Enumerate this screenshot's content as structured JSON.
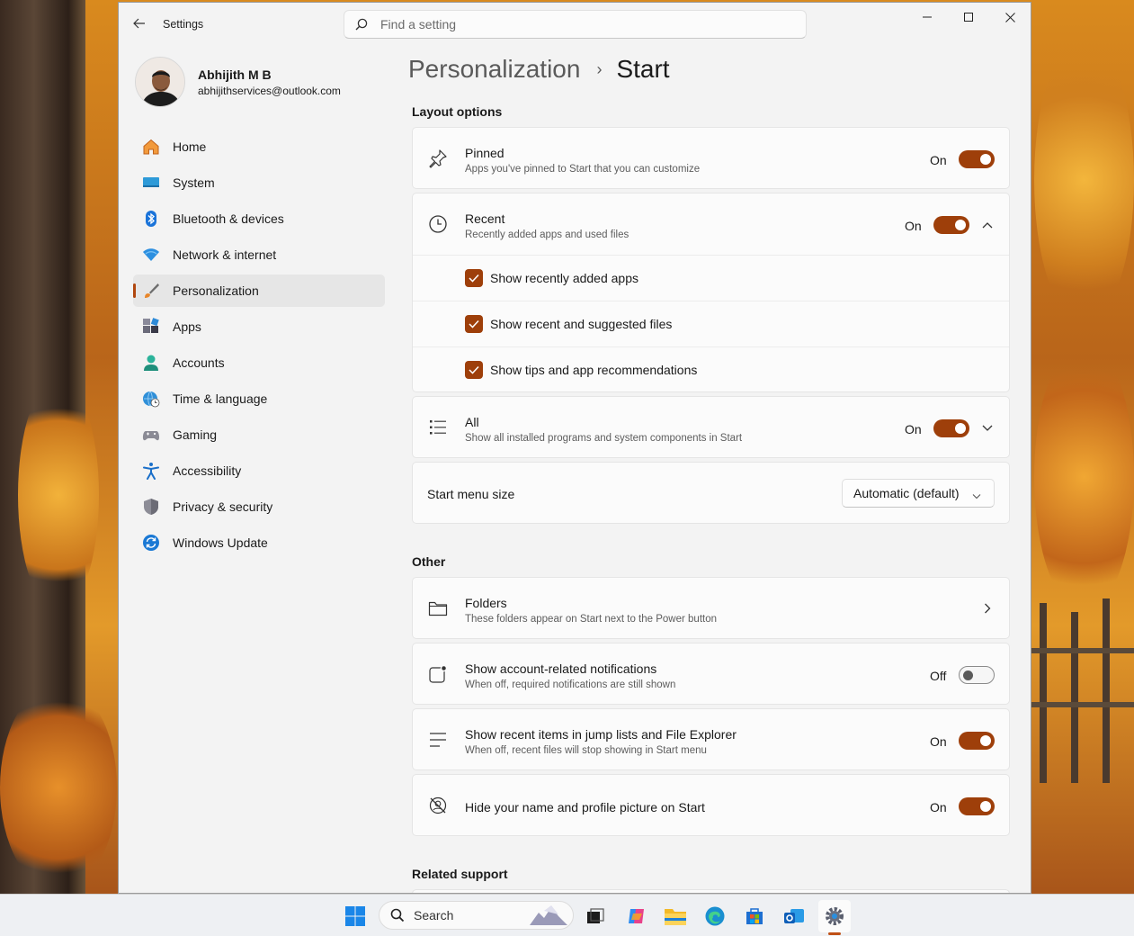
{
  "window": {
    "app_title": "Settings",
    "search_placeholder": "Find a setting"
  },
  "profile": {
    "name": "Abhijith M B",
    "email": "abhijithservices@outlook.com"
  },
  "nav": {
    "items": [
      {
        "label": "Home",
        "icon": "home-icon"
      },
      {
        "label": "System",
        "icon": "monitor-icon"
      },
      {
        "label": "Bluetooth & devices",
        "icon": "bluetooth-icon"
      },
      {
        "label": "Network & internet",
        "icon": "wifi-icon"
      },
      {
        "label": "Personalization",
        "icon": "brush-icon",
        "selected": true
      },
      {
        "label": "Apps",
        "icon": "apps-icon"
      },
      {
        "label": "Accounts",
        "icon": "person-icon"
      },
      {
        "label": "Time & language",
        "icon": "globe-clock-icon"
      },
      {
        "label": "Gaming",
        "icon": "gamepad-icon"
      },
      {
        "label": "Accessibility",
        "icon": "accessibility-icon"
      },
      {
        "label": "Privacy & security",
        "icon": "shield-icon"
      },
      {
        "label": "Windows Update",
        "icon": "update-icon"
      }
    ]
  },
  "breadcrumb": {
    "parent": "Personalization",
    "separator": "›",
    "current": "Start"
  },
  "layout_options": {
    "title": "Layout options",
    "pinned": {
      "title": "Pinned",
      "desc": "Apps you've pinned to Start that you can customize",
      "state": "On"
    },
    "recent": {
      "title": "Recent",
      "desc": "Recently added apps and used files",
      "state": "On",
      "sub_items": [
        {
          "label": "Show recently added apps",
          "checked": true
        },
        {
          "label": "Show recent and suggested files",
          "checked": true
        },
        {
          "label": "Show tips and app recommendations",
          "checked": true
        }
      ]
    },
    "all": {
      "title": "All",
      "desc": "Show all installed programs and system components in Start",
      "state": "On"
    },
    "menu_size": {
      "title": "Start menu size",
      "value": "Automatic (default)"
    }
  },
  "other": {
    "title": "Other",
    "folders": {
      "title": "Folders",
      "desc": "These folders appear on Start next to the Power button"
    },
    "account_notifications": {
      "title": "Show account-related notifications",
      "desc": "When off, required notifications are still shown",
      "state": "Off"
    },
    "jump_lists": {
      "title": "Show recent items in jump lists and File Explorer",
      "desc": "When off, recent files will stop showing in Start menu",
      "state": "On"
    },
    "hide_profile": {
      "title": "Hide your name and profile picture on Start",
      "state": "On"
    }
  },
  "related_support": {
    "title": "Related support"
  },
  "taskbar": {
    "search_label": "Search",
    "items": [
      "windows-start-icon",
      "task-view-icon",
      "copilot-icon",
      "file-explorer-icon",
      "edge-icon",
      "store-icon",
      "outlook-icon",
      "settings-gear-icon"
    ]
  },
  "colors": {
    "accent": "#9e3f0a",
    "window_bg": "#f3f3f3",
    "card_bg": "#fbfbfb"
  }
}
